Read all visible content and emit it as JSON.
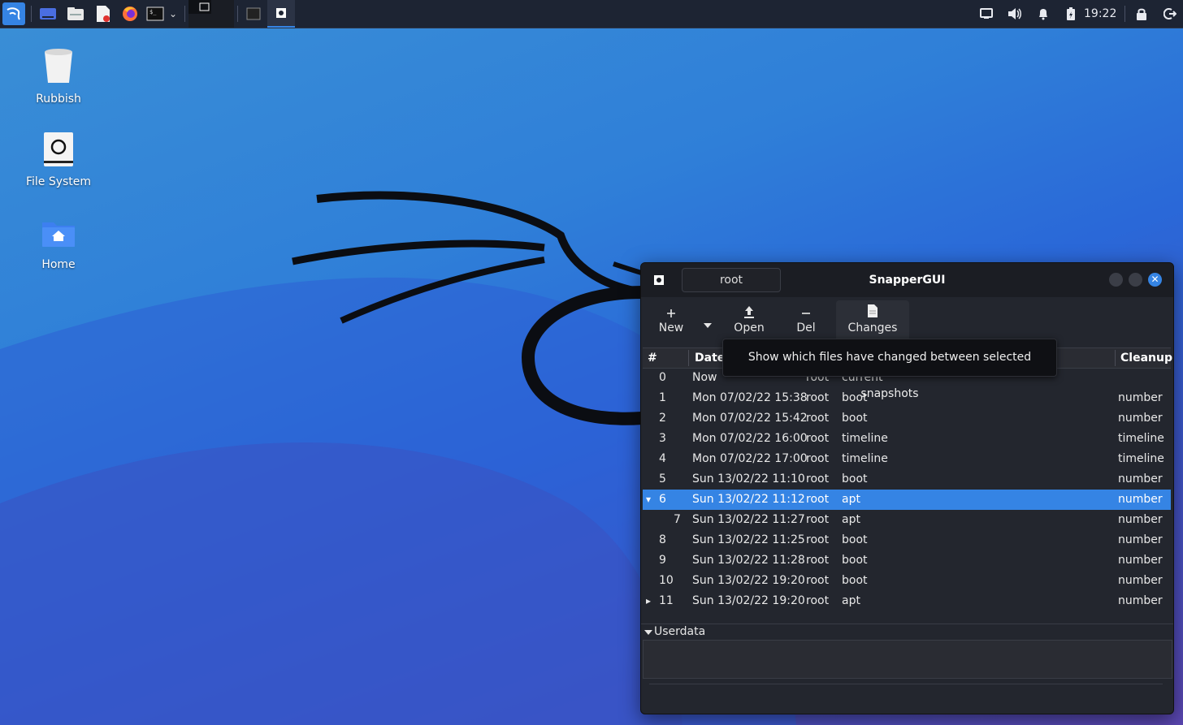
{
  "panel": {
    "clock": "19:22",
    "launchers": [
      "kali-menu-icon",
      "desktop-icon",
      "file-manager-icon",
      "text-editor-icon",
      "firefox-icon",
      "terminal-icon"
    ],
    "tray": [
      "screen-icon",
      "volume-icon",
      "bell-icon",
      "battery-icon"
    ],
    "tray_right": [
      "lock-icon",
      "logout-icon"
    ]
  },
  "desktop": {
    "icons": [
      {
        "label": "Rubbish"
      },
      {
        "label": "File System"
      },
      {
        "label": "Home"
      }
    ]
  },
  "window": {
    "title": "SnapperGUI",
    "config": "root",
    "toolbar": {
      "new": "New",
      "open": "Open",
      "del": "Del",
      "changes": "Changes"
    },
    "tooltip": "Show which files have changed between selected snapshots",
    "columns": {
      "num": "#",
      "date": "Date",
      "cleanup": "Cleanup"
    },
    "rows": [
      {
        "num": "0",
        "date": "Now",
        "user": "root",
        "type": "current",
        "cleanup": "",
        "expander": "",
        "indent": false,
        "selected": false
      },
      {
        "num": "1",
        "date": "Mon 07/02/22 15:38",
        "user": "root",
        "type": "boot",
        "cleanup": "number",
        "expander": "",
        "indent": false,
        "selected": false
      },
      {
        "num": "2",
        "date": "Mon 07/02/22 15:42",
        "user": "root",
        "type": "boot",
        "cleanup": "number",
        "expander": "",
        "indent": false,
        "selected": false
      },
      {
        "num": "3",
        "date": "Mon 07/02/22 16:00",
        "user": "root",
        "type": "timeline",
        "cleanup": "timeline",
        "expander": "",
        "indent": false,
        "selected": false
      },
      {
        "num": "4",
        "date": "Mon 07/02/22 17:00",
        "user": "root",
        "type": "timeline",
        "cleanup": "timeline",
        "expander": "",
        "indent": false,
        "selected": false
      },
      {
        "num": "5",
        "date": "Sun 13/02/22 11:10",
        "user": "root",
        "type": "boot",
        "cleanup": "number",
        "expander": "",
        "indent": false,
        "selected": false
      },
      {
        "num": "6",
        "date": "Sun 13/02/22 11:12",
        "user": "root",
        "type": "apt",
        "cleanup": "number",
        "expander": "▾",
        "indent": false,
        "selected": true
      },
      {
        "num": "7",
        "date": "Sun 13/02/22 11:27",
        "user": "root",
        "type": "apt",
        "cleanup": "number",
        "expander": "",
        "indent": true,
        "selected": false
      },
      {
        "num": "8",
        "date": "Sun 13/02/22 11:25",
        "user": "root",
        "type": "boot",
        "cleanup": "number",
        "expander": "",
        "indent": false,
        "selected": false
      },
      {
        "num": "9",
        "date": "Sun 13/02/22 11:28",
        "user": "root",
        "type": "boot",
        "cleanup": "number",
        "expander": "",
        "indent": false,
        "selected": false
      },
      {
        "num": "10",
        "date": "Sun 13/02/22 19:20",
        "user": "root",
        "type": "boot",
        "cleanup": "number",
        "expander": "",
        "indent": false,
        "selected": false
      },
      {
        "num": "11",
        "date": "Sun 13/02/22 19:20",
        "user": "root",
        "type": "apt",
        "cleanup": "number",
        "expander": "▸",
        "indent": false,
        "selected": false
      }
    ],
    "userdata_label": "Userdata"
  }
}
